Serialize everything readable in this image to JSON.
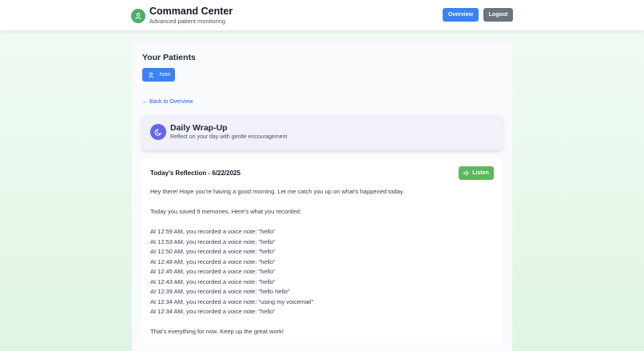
{
  "header": {
    "title": "Command Center",
    "subtitle": "Advanced patient monitoring",
    "overview_label": "Overview",
    "logout_label": "Logout"
  },
  "patients": {
    "heading": "Your Patients",
    "items": [
      {
        "name": "tvon"
      }
    ]
  },
  "back_link": "← Back to Overview",
  "wrapup": {
    "title": "Daily Wrap-Up",
    "subtitle": "Reflect on your day with gentle encouragement"
  },
  "reflection": {
    "title": "Today's Reflection - 6/22/2025",
    "listen_label": "Listen",
    "greeting": "Hey there! Hope you're having a good morning. Let me catch you up on what's happened today.",
    "summary": "Today you saved 9 memories. Here's what you recorded:",
    "entries": [
      "At 12:59 AM, you recorded a voice note: \"hello\"",
      "At 12:53 AM, you recorded a voice note: \"hello\"",
      "At 12:50 AM, you recorded a voice note: \"hello\"",
      "At 12:48 AM, you recorded a voice note: \"hello\"",
      "At 12:45 AM, you recorded a voice note: \"hello\"",
      "At 12:43 AM, you recorded a voice note: \"hello\"",
      "At 12:39 AM, you recorded a voice note: \"hello hello\"",
      "At 12:34 AM, you recorded a voice note: \"using my voicemail\"",
      "At 12:34 AM, you recorded a voice note: \"hello\""
    ],
    "closing": "That's everything for now. Keep up the great work!"
  },
  "icons": {
    "brand": "user-icon",
    "patient": "user-icon",
    "wrapup": "moon-icon",
    "listen": "speaker-icon"
  },
  "colors": {
    "primary": "#3b82f6",
    "logout": "#6b7280",
    "listen": "#5cb85c",
    "brand": "#4caf6a",
    "wrapup_icon": "#6366f1"
  }
}
